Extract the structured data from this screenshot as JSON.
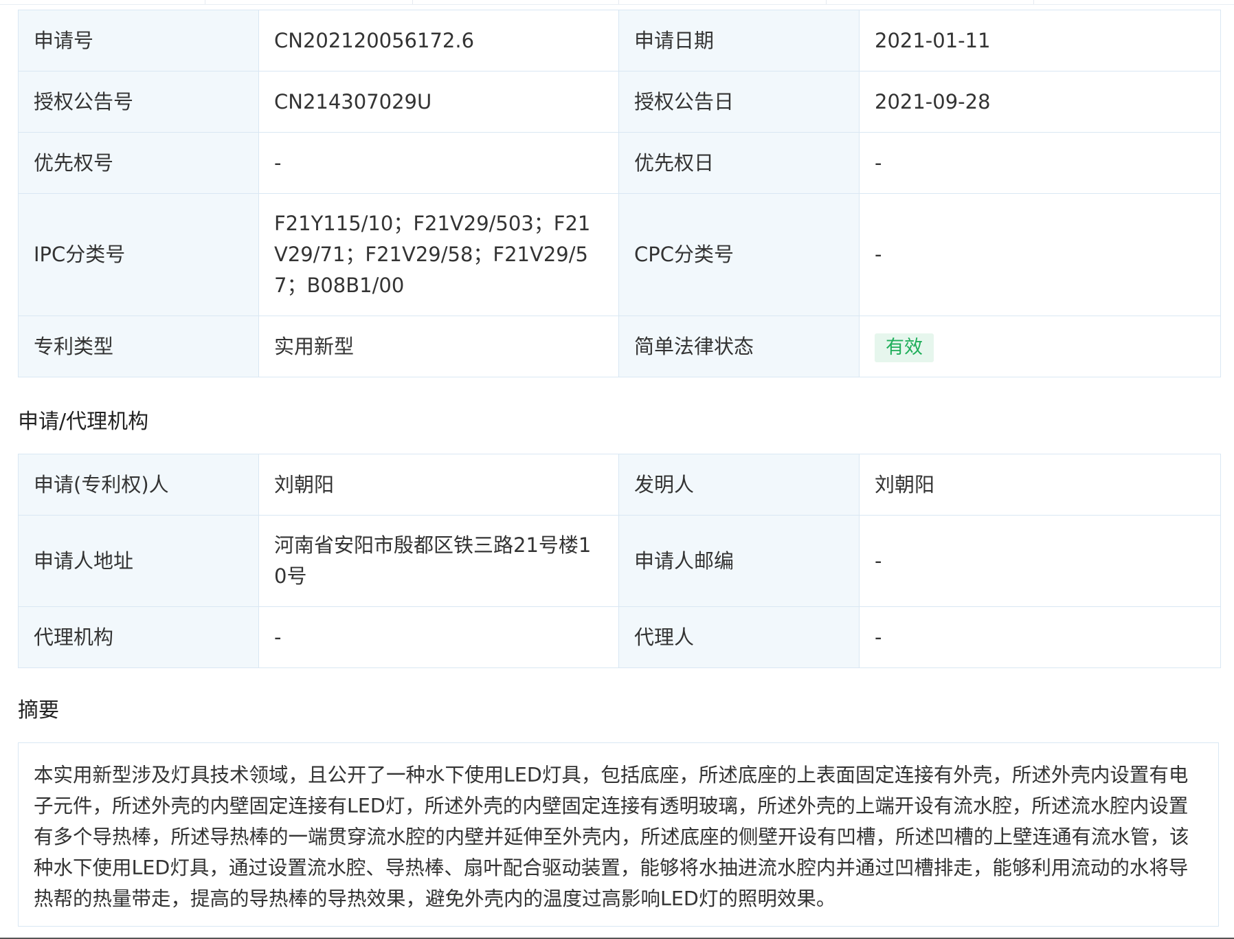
{
  "basic_info": {
    "rows": [
      {
        "label1": "申请号",
        "value1": "CN202120056172.6",
        "label2": "申请日期",
        "value2": "2021-01-11"
      },
      {
        "label1": "授权公告号",
        "value1": "CN214307029U",
        "label2": "授权公告日",
        "value2": "2021-09-28"
      },
      {
        "label1": "优先权号",
        "value1": "-",
        "label2": "优先权日",
        "value2": "-"
      },
      {
        "label1": "IPC分类号",
        "value1": "F21Y115/10；F21V29/503；F21V29/71；F21V29/58；F21V29/57；B08B1/00",
        "label2": "CPC分类号",
        "value2": "-"
      },
      {
        "label1": "专利类型",
        "value1": "实用新型",
        "label2": "简单法律状态",
        "value2": "有效"
      }
    ],
    "status_color": "#1fae5a"
  },
  "agency_section": {
    "title": "申请/代理机构",
    "rows": [
      {
        "label1": "申请(专利权)人",
        "value1": "刘朝阳",
        "label2": "发明人",
        "value2": "刘朝阳"
      },
      {
        "label1": "申请人地址",
        "value1": "河南省安阳市殷都区铁三路21号楼10号",
        "label2": "申请人邮编",
        "value2": "-"
      },
      {
        "label1": "代理机构",
        "value1": "-",
        "label2": "代理人",
        "value2": "-"
      }
    ]
  },
  "abstract_section": {
    "title": "摘要",
    "text": "本实用新型涉及灯具技术领域，且公开了一种水下使用LED灯具，包括底座，所述底座的上表面固定连接有外壳，所述外壳内设置有电子元件，所述外壳的内壁固定连接有LED灯，所述外壳的内壁固定连接有透明玻璃，所述外壳的上端开设有流水腔，所述流水腔内设置有多个导热棒，所述导热棒的一端贯穿流水腔的内壁并延伸至外壳内，所述底座的侧壁开设有凹槽，所述凹槽的上壁连通有流水管，该种水下使用LED灯具，通过设置流水腔、导热棒、扇叶配合驱动装置，能够将水抽进流水腔内并通过凹槽排走，能够利用流动的水将导热帮的热量带走，提高的导热棒的导热效果，避免外壳内的温度过高影响LED灯的照明效果。"
  }
}
